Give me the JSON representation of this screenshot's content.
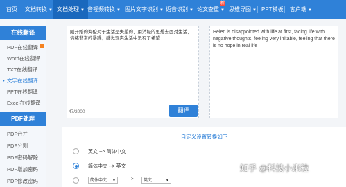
{
  "nav": {
    "items": [
      {
        "label": "首页"
      },
      {
        "label": "文档转换"
      },
      {
        "label": "文档处理"
      },
      {
        "label": "音视频转换"
      },
      {
        "label": "图片文字识别"
      },
      {
        "label": "语音识别"
      },
      {
        "label": "论文查重"
      },
      {
        "label": "思维导图"
      },
      {
        "label": "PPT模板"
      },
      {
        "label": "客户端"
      }
    ],
    "badge_label": "新"
  },
  "sidebar": {
    "section1_title": "在线翻译",
    "section1_items": [
      "PDF在线翻译",
      "Word在线翻译",
      "TXT在线翻译",
      "文字在线翻译",
      "PPT在线翻译",
      "Excel在线翻译"
    ],
    "section2_title": "PDF处理",
    "section2_items": [
      "PDF合并",
      "PDF分割",
      "PDF密码解除",
      "PDF增加密码",
      "PDF修改密码"
    ]
  },
  "input": {
    "text": "刚开始的海伦对于生活是失望的，用消极的思想去面对生活，情绪非常的暴躁，感觉现实生活中没有了希望",
    "counter": "47/2000"
  },
  "translate_button": "翻译",
  "output": {
    "text": "Helen is disappointed with life at first, facing life with negative thoughts, feeling very irritable, feeling that there is no hope in real life"
  },
  "settings": {
    "title": "自定义设置转换如下",
    "options": [
      {
        "label": "英文 --> 简体中文",
        "selected": false
      },
      {
        "label": "简体中文 --> 英文",
        "selected": true
      }
    ],
    "custom": {
      "from": "简体中文",
      "arrow": "-->",
      "to": "英文"
    }
  },
  "watermark": "知乎 @科技小米粒",
  "colors": {
    "primary": "#2f81d8",
    "nav_active": "#1a68bd",
    "hot": "#f58220"
  }
}
